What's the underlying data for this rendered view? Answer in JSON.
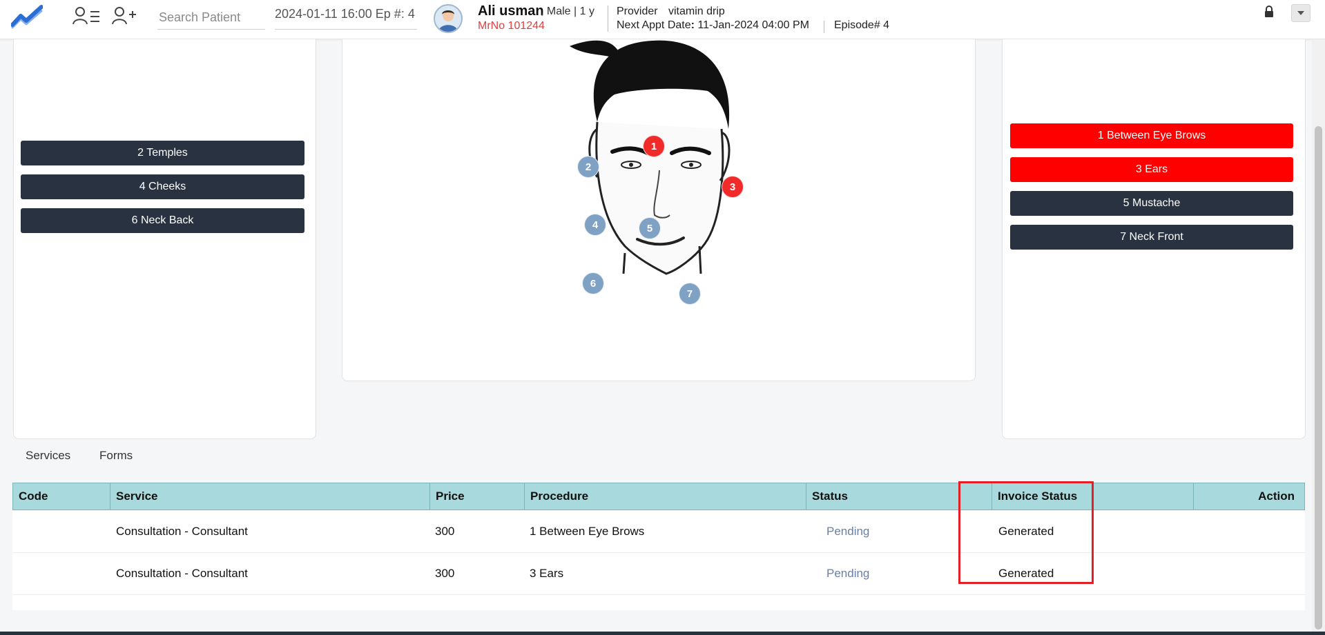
{
  "header": {
    "search_placeholder": "Search Patient",
    "episode_select": "2024-01-11 16:00 Ep #: 4",
    "patient_name": "Ali usman",
    "patient_meta": ", Male | 1 y",
    "mrn": "MrNo 101244",
    "provider_label": "Provider",
    "provider_value": "vitamin drip",
    "appt_label": "Next Appt Date",
    "appt_colon": ":",
    "appt_value": "11-Jan-2024 04:00 PM",
    "episode_label": "Episode# 4"
  },
  "left_zones": [
    {
      "label": "2 Temples"
    },
    {
      "label": "4 Cheeks"
    },
    {
      "label": "6 Neck Back"
    }
  ],
  "right_zones": [
    {
      "label": "1 Between Eye Brows",
      "selected": true
    },
    {
      "label": "3 Ears",
      "selected": true
    },
    {
      "label": "5 Mustache",
      "selected": false
    },
    {
      "label": "7 Neck Front",
      "selected": false
    }
  ],
  "markers": [
    {
      "label": "1",
      "selected": true
    },
    {
      "label": "2",
      "selected": false
    },
    {
      "label": "3",
      "selected": true
    },
    {
      "label": "4",
      "selected": false
    },
    {
      "label": "5",
      "selected": false
    },
    {
      "label": "6",
      "selected": false
    },
    {
      "label": "7",
      "selected": false
    }
  ],
  "tabs": [
    "Services",
    "Forms"
  ],
  "table": {
    "headers": [
      "Code",
      "Service",
      "Price",
      "Procedure",
      "Status",
      "Invoice Status",
      "Action"
    ],
    "rows": [
      {
        "code": "",
        "service": "Consultation - Consultant",
        "price": "300",
        "procedure": "1 Between Eye Brows",
        "status": "Pending",
        "invoice_status": "Generated",
        "action": ""
      },
      {
        "code": "",
        "service": "Consultation - Consultant",
        "price": "300",
        "procedure": "3 Ears",
        "status": "Pending",
        "invoice_status": "Generated",
        "action": ""
      }
    ]
  },
  "colors": {
    "selected": "#ff0000",
    "unselected": "#283240",
    "marker_blue": "#7ea1c4",
    "table_header": "#a8d9dc",
    "highlight": "#e31e24"
  }
}
